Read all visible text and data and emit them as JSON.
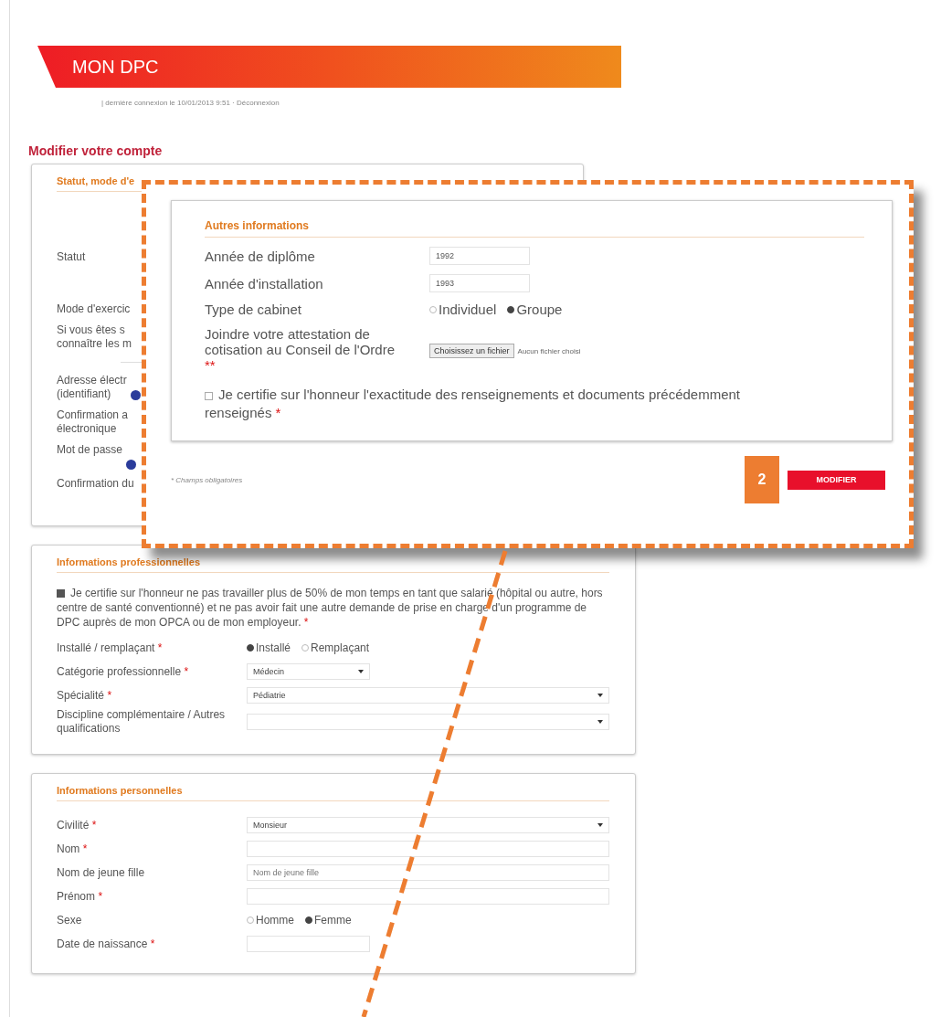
{
  "header": {
    "title": "MON DPC",
    "session_info": "| dernière connexion le 10/01/2013 9:51 · Déconnexion"
  },
  "page_title": "Modifier votre compte",
  "account_section": {
    "title": "Statut, mode d'e",
    "rows": [
      {
        "kind": "field",
        "lines": [
          "Statut"
        ],
        "help": false
      },
      {
        "kind": "field",
        "lines": [
          "Mode d'exercic"
        ],
        "help": false
      },
      {
        "kind": "field",
        "lines": [
          "Si vous êtes s",
          "connaître les m"
        ],
        "help": false
      },
      {
        "kind": "divider"
      },
      {
        "kind": "field",
        "lines": [
          "Adresse électr",
          "(identifiant)"
        ],
        "help": true
      },
      {
        "kind": "field",
        "lines": [
          "Confirmation a",
          "électronique"
        ],
        "help": false
      },
      {
        "kind": "field",
        "lines": [
          "Mot de passe"
        ],
        "help": true
      },
      {
        "kind": "field",
        "lines": [
          "Confirmation du"
        ],
        "help": false
      }
    ]
  },
  "callout": {
    "badge": "2",
    "section_title": "Autres informations",
    "fields": [
      {
        "kind": "text",
        "label": "Année de diplôme",
        "value": "1992"
      },
      {
        "kind": "text",
        "label": "Année d'installation",
        "value": "1993"
      },
      {
        "kind": "radio",
        "label": "Type de cabinet",
        "options": [
          {
            "label": "Individuel",
            "selected": false
          },
          {
            "label": "Groupe",
            "selected": true
          }
        ]
      },
      {
        "kind": "file",
        "label": "Joindre votre attestation de cotisation au Conseil de l'Ordre",
        "required_mark": "**",
        "button": "Choisissez un fichier",
        "status": "Aucun fichier choisi"
      }
    ],
    "certify": {
      "checked": false,
      "text": "Je certifie sur l'honneur l'exactitude des renseignements et documents précédemment renseignés",
      "required_mark": "*"
    },
    "footnote": "* Champs obligatoires",
    "submit": "MODIFIER"
  },
  "sections": [
    {
      "title": "Informations professionnelles",
      "certify": {
        "checked": true,
        "text": "Je certifie sur l'honneur ne pas travailler plus de 50% de mon temps en tant que salarié (hôpital ou autre, hors centre de santé conventionné) et ne pas avoir fait une autre demande de prise en charge d'un programme de DPC auprès de mon OPCA ou de mon employeur.",
        "required_mark": "*"
      },
      "fields": [
        {
          "kind": "radio",
          "label": "Installé / remplaçant",
          "required_mark": "*",
          "options": [
            {
              "label": "Installé",
              "selected": true
            },
            {
              "label": "Remplaçant",
              "selected": false
            }
          ]
        },
        {
          "kind": "shortselect",
          "label": "Catégorie professionnelle",
          "required_mark": "*",
          "value": "Médecin"
        },
        {
          "kind": "select",
          "label": "Spécialité",
          "required_mark": "*",
          "value": "Pédiatrie"
        },
        {
          "kind": "select",
          "label": "Discipline complémentaire / Autres qualifications"
        }
      ]
    },
    {
      "title": "Informations personnelles",
      "fields": [
        {
          "kind": "select",
          "label": "Civilité",
          "required_mark": "*",
          "value": "Monsieur"
        },
        {
          "kind": "text",
          "label": "Nom",
          "required_mark": "*"
        },
        {
          "kind": "text",
          "label": "Nom de jeune fille",
          "placeholder": "Nom de jeune fille"
        },
        {
          "kind": "text",
          "label": "Prénom",
          "required_mark": "*"
        },
        {
          "kind": "radio",
          "label": "Sexe",
          "options": [
            {
              "label": "Homme",
              "selected": false
            },
            {
              "label": "Femme",
              "selected": true
            }
          ]
        },
        {
          "kind": "shorttext",
          "label": "Date de naissance",
          "required_mark": "*"
        }
      ]
    }
  ]
}
